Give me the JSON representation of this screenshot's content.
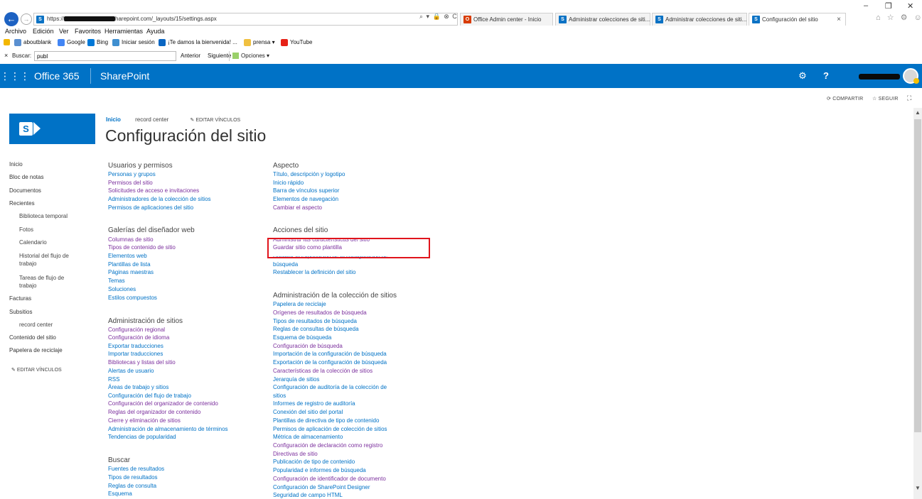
{
  "browser": {
    "url_prefix": "https://",
    "url_suffix": "harepoint.com/_layouts/15/settings.aspx",
    "address_tools": "⌕ ▾ 🔒 ⊗ C",
    "tabs": [
      {
        "label": "Office Admin center - Inicio"
      },
      {
        "label": "Administrar colecciones de siti..."
      },
      {
        "label": "Administrar colecciones de siti..."
      },
      {
        "label": "Configuración del sitio",
        "close": "×"
      }
    ],
    "window_controls": {
      "minimize": "–",
      "restore": "❐",
      "close": "✕"
    },
    "ie_icons": "⌂ ☆ ⚙ ☺",
    "menu": [
      "Archivo",
      "Edición",
      "Ver",
      "Favoritos",
      "Herramientas",
      "Ayuda"
    ],
    "favorites": [
      "aboutblank",
      "Google",
      "Bing",
      "Iniciar sesión",
      "¡Te damos la bienvenida! ...",
      "prensa ▾",
      "YouTube"
    ],
    "find": {
      "close": "×",
      "label": "Buscar:",
      "value": "publ",
      "prev": "Anterior",
      "next": "Siguiente",
      "options": "Opciones ▾"
    }
  },
  "suite": {
    "brand": "Office 365",
    "app": "SharePoint",
    "waffle": "⋮⋮⋮",
    "gear": "⚙",
    "help": "?"
  },
  "actions": {
    "share": "COMPARTIR",
    "follow": "SEGUIR",
    "focus": "⛶"
  },
  "breadcrumb": {
    "home": "Inicio",
    "record_center": "record center",
    "edit_links": "EDITAR VÍNCULOS"
  },
  "page_title": "Configuración del sitio",
  "quick_launch": [
    {
      "label": "Inicio"
    },
    {
      "label": "Bloc de notas"
    },
    {
      "label": "Documentos"
    },
    {
      "label": "Recientes"
    },
    {
      "label": "Biblioteca temporal"
    },
    {
      "label": "Fotos"
    },
    {
      "label": "Calendario"
    },
    {
      "label": "Historial del flujo de"
    },
    {
      "label": "trabajo"
    },
    {
      "label": "Tareas de flujo de"
    },
    {
      "label": "trabajo"
    },
    {
      "label": "Facturas"
    },
    {
      "label": "Subsitios"
    },
    {
      "label": "record center"
    },
    {
      "label": "Contenido del sitio"
    },
    {
      "label": "Papelera de reciclaje"
    }
  ],
  "quick_launch_edit": "EDITAR VÍNCULOS",
  "sections": {
    "users": {
      "title": "Usuarios y permisos",
      "links": [
        "Personas y grupos",
        "Permisos del sitio",
        "Solicitudes de acceso e invitaciones",
        "Administradores de la colección de sitios",
        "Permisos de aplicaciones del sitio"
      ]
    },
    "galleries": {
      "title": "Galerías del diseñador web",
      "links": [
        "Columnas de sitio",
        "Tipos de contenido de sitio",
        "Elementos web",
        "Plantillas de lista",
        "Páginas maestras",
        "Temas",
        "Soluciones",
        "Estilos compuestos"
      ]
    },
    "site_admin": {
      "title": "Administración de sitios",
      "links": [
        "Configuración regional",
        "Configuración de idioma",
        "Exportar traducciones",
        "Importar traducciones",
        "Bibliotecas y listas del sitio",
        "Alertas de usuario",
        "RSS",
        "Áreas de trabajo y sitios",
        "Configuración del flujo de trabajo",
        "Configuración del organizador de contenido",
        "Reglas del organizador de contenido",
        "Cierre y eliminación de sitios",
        "Administración de almacenamiento de términos",
        "Tendencias de popularidad"
      ]
    },
    "search": {
      "title": "Buscar",
      "links": [
        "Fuentes de resultados",
        "Tipos de resultados",
        "Reglas de consulta",
        "Esquema"
      ]
    },
    "look": {
      "title": "Aspecto",
      "links": [
        "Título, descripción y logotipo",
        "Inicio rápido",
        "Barra de vínculos superior",
        "Elementos de navegación",
        "Cambiar el aspecto"
      ]
    },
    "site_actions": {
      "title": "Acciones del sitio",
      "links": [
        "Administrar las características del sitio",
        "Guardar sitio como plantilla",
        "Habilitar la exportación de la configuración de",
        "búsqueda",
        "Restablecer la definición del sitio"
      ]
    },
    "collection_admin": {
      "title": "Administración de la colección de sitios",
      "links": [
        "Papelera de reciclaje",
        "Orígenes de resultados de búsqueda",
        "Tipos de resultados de búsqueda",
        "Reglas de consultas de búsqueda",
        "Esquema de búsqueda",
        "Configuración de búsqueda",
        "Importación de la configuración de búsqueda",
        "Exportación de la configuración de búsqueda",
        "Características de la colección de sitios",
        "Jerarquía de sitios",
        "Configuración de auditoría de la colección de",
        "sitios",
        "Informes de registro de auditoría",
        "Conexión del sitio del portal",
        "Plantillas de directiva de tipo de contenido",
        "Permisos de aplicación de colección de sitios",
        "Métrica de almacenamiento",
        "Configuración de declaración como registro",
        "Directivas de sitio",
        "Publicación de tipo de contenido",
        "Popularidad e informes de búsqueda",
        "Configuración de identificador de documento",
        "Configuración de SharePoint Designer",
        "Seguridad de campo HTML"
      ]
    }
  },
  "colors": {
    "suite_blue": "#0072c6",
    "link_blue": "#0072c6",
    "visited_purple": "#7b2f9d",
    "highlight_red": "#e0141c"
  }
}
